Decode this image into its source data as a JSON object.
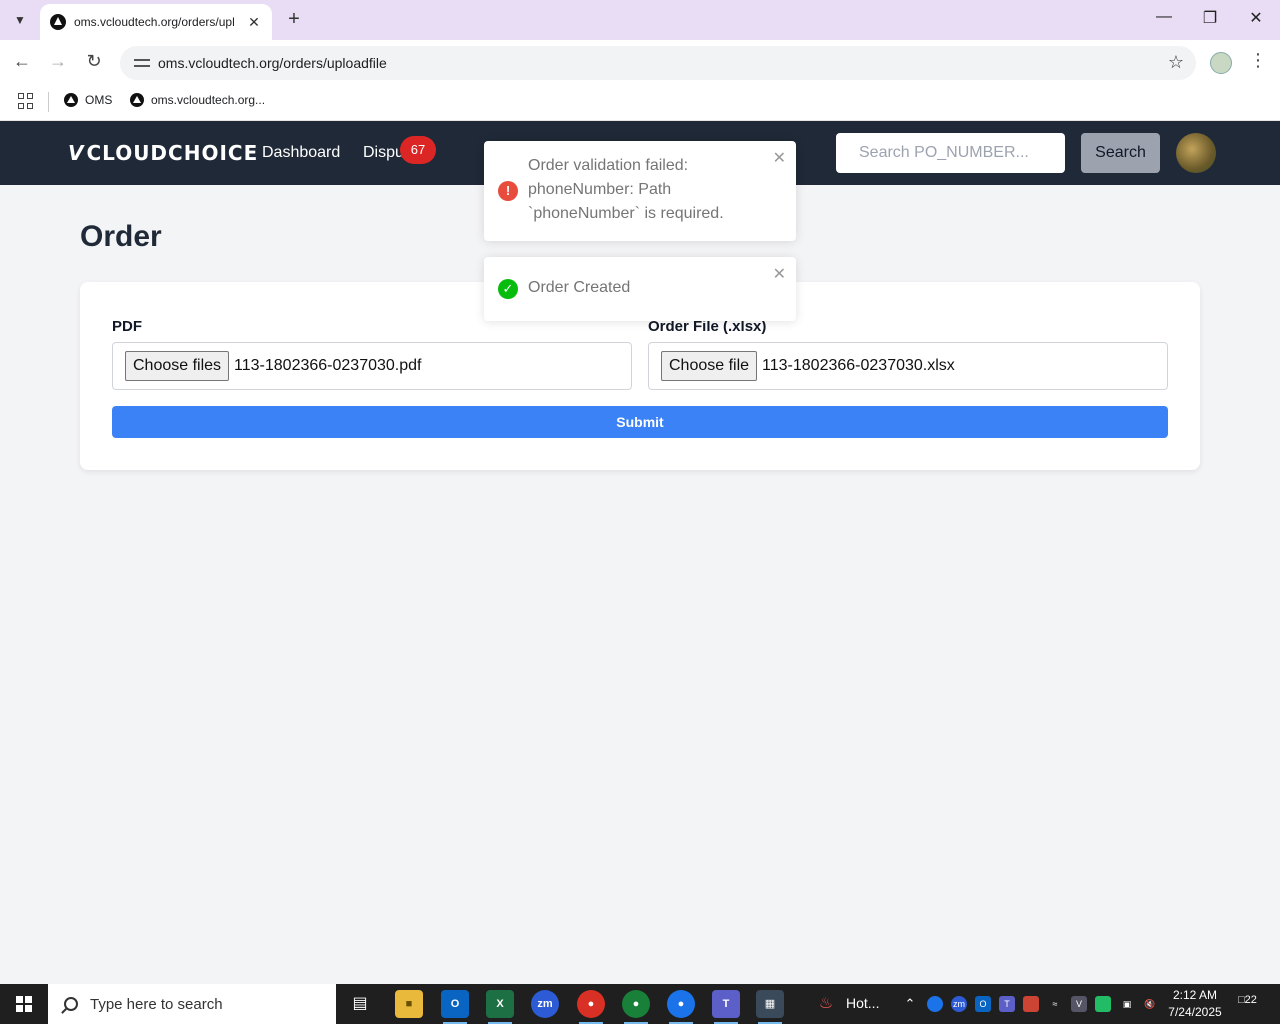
{
  "browser": {
    "tab_title": "oms.vcloudtech.org/orders/upl",
    "url": "oms.vcloudtech.org/orders/uploadfile",
    "bookmarks": [
      {
        "label": "OMS"
      },
      {
        "label": "oms.vcloudtech.org..."
      }
    ]
  },
  "appnav": {
    "logo": "CLOUDCHOICE",
    "links": [
      "Dashboard",
      "Dispu"
    ],
    "badge_count": "67",
    "search_placeholder": "Search PO_NUMBER...",
    "search_label": "Search"
  },
  "page": {
    "title": "Order",
    "pdf_label": "PDF",
    "pdf_button": "Choose files",
    "pdf_filename": "113-1802366-0237030.pdf",
    "order_label": "Order File (.xlsx)",
    "order_button": "Choose file",
    "order_filename": "113-1802366-0237030.xlsx",
    "submit_label": "Submit"
  },
  "toasts": [
    {
      "type": "error",
      "lines": [
        "Order validation failed:",
        "phoneNumber: Path",
        "`phoneNumber` is required."
      ],
      "color": "#e74c3c"
    },
    {
      "type": "success",
      "lines": [
        "Order Created"
      ],
      "color": "#07bc0c"
    }
  ],
  "taskbar": {
    "search_placeholder": "Type here to search",
    "weather": "Hot...",
    "time": "2:12 AM",
    "date": "7/24/2025",
    "notifications": "22"
  },
  "colors": {
    "nav_bg": "#1f2937",
    "submit_bg": "#3b82f6",
    "badge_bg": "#dc2626"
  }
}
